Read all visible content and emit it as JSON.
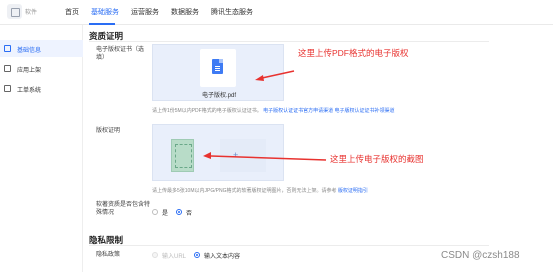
{
  "header": {
    "app_name": "软件",
    "nav": [
      "首页",
      "基础服务",
      "运营服务",
      "数据服务",
      "腾讯生态服务"
    ],
    "active_index": 1
  },
  "sidebar": {
    "items": [
      "基础信息",
      "应用上架",
      "工单系统"
    ],
    "active_index": 0
  },
  "qualification": {
    "title": "资质证明",
    "ecopyright_label": "电子版权证书（选填）",
    "pdf_file_name": "电子版权.pdf",
    "ecopyright_hint": "请上传1份5M以内PDF格式的电子版权认证证书。",
    "ecopyright_link": "电子版权认证证书官方申请渠道 电子版权认证证书补领渠道",
    "copyright_label": "版权证明",
    "copyright_hint": "请上传最多5张10M以内JPG/PNG格式的软著版权证明图片，否则无法上架。请参考",
    "copyright_link": "版权证明指引",
    "exceptions_label": "软著资质是否包含特殊情况",
    "radio_yes": "是",
    "radio_no": "否",
    "selected": "否"
  },
  "privacy": {
    "title": "隐私限制",
    "policy_label": "隐私政策",
    "option_url": "输入URL",
    "option_text": "输入文本内容",
    "selected": "输入文本内容"
  },
  "annotations": {
    "pdf_note": "这里上传PDF格式的电子版权",
    "image_note": "这里上传电子版权的截图",
    "color": "#e8322f"
  },
  "watermark": "CSDN @czsh188",
  "colors": {
    "accent": "#2a6df4",
    "upload_bg": "#e9effb"
  }
}
